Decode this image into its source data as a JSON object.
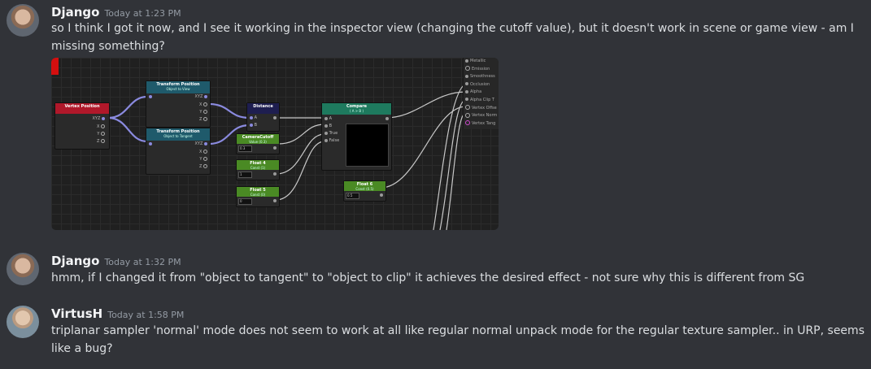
{
  "messages": [
    {
      "username": "Django",
      "timestamp": "Today at 1:23 PM",
      "text": "so I think I got it now, and I see it working in the inspector view (changing the cutoff value), but it doesn't work in scene or game view - am I missing something?"
    },
    {
      "username": "Django",
      "timestamp": "Today at 1:32 PM",
      "text": "hmm, if I changed it from \"object to tangent\" to \"object to clip\" it achieves the desired effect - not sure why this is different from SG"
    },
    {
      "username": "VirtusH",
      "timestamp": "Today at 1:58 PM",
      "text": "triplanar sampler 'normal' mode does not seem to work at all like regular normal unpack mode for the regular texture sampler.. in URP, seems like a bug?"
    }
  ],
  "graph": {
    "nodes": {
      "vertex_position": {
        "title": "Vertex Position",
        "color": "#b0182a",
        "port_out": "XYZ",
        "ports": [
          "X",
          "Y",
          "Z"
        ]
      },
      "transform_1": {
        "title": "Transform Position",
        "subtitle": "Object to View",
        "color": "#1f5a6b",
        "ports": [
          "XYZ",
          "X",
          "Y",
          "Z"
        ]
      },
      "transform_2": {
        "title": "Transform Position",
        "subtitle": "Object to Tangent",
        "color": "#1f5a6b",
        "ports": [
          "XYZ",
          "X",
          "Y",
          "Z"
        ]
      },
      "distance": {
        "title": "Distance",
        "color": "#1e1e50",
        "ports": [
          "A",
          "B"
        ]
      },
      "camera_cutoff": {
        "title": "CameraCutoff",
        "subtitle": "Value (0.3)",
        "color": "#4a8a24",
        "field": "0.3"
      },
      "float_4": {
        "title": "Float 4",
        "subtitle": "Const (1)",
        "color": "#4a8a24",
        "field": "1"
      },
      "float_5": {
        "title": "Float 5",
        "subtitle": "Const (0)",
        "color": "#4a8a24",
        "field": "0"
      },
      "compare": {
        "title": "Compare",
        "subtitle": "( A > B )",
        "color": "#1e7a5e",
        "ports": [
          "A",
          "B",
          "True",
          "False"
        ]
      },
      "float_6": {
        "title": "Float 6",
        "subtitle": "Const (0.5)",
        "color": "#4a8a24",
        "field": "0.5"
      }
    },
    "master_outputs": [
      "Metallic",
      "Emission",
      "Smoothness",
      "Occlusion",
      "Alpha",
      "Alpha Clip T",
      "Vertex Offse",
      "Vertex Norm",
      "Vertex Tang"
    ],
    "accent_red": "#d40f0f"
  },
  "colors": {
    "background": "#313338",
    "username": "#f2f3f5",
    "timestamp": "#949ba4",
    "text": "#dbdee1"
  }
}
